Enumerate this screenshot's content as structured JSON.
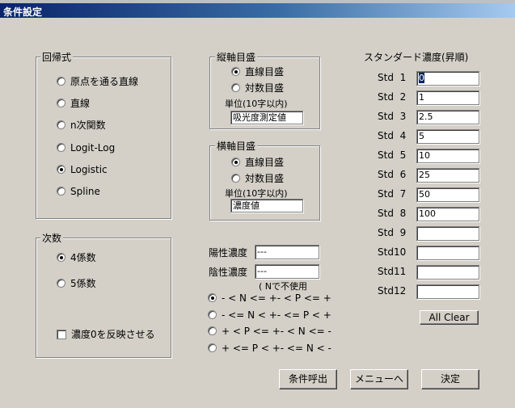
{
  "window": {
    "title": "条件設定"
  },
  "regression": {
    "label": "回帰式",
    "options": [
      "原点を通る直線",
      "直線",
      "n次関数",
      "Logit-Log",
      "Logistic",
      "Spline"
    ],
    "selected": 4
  },
  "vertical_axis": {
    "label": "縦軸目盛",
    "options": [
      "直線目盛",
      "対数目盛"
    ],
    "selected": 0,
    "unit_label": "単位(10字以内)",
    "unit_value": "吸光度測定値"
  },
  "horizontal_axis": {
    "label": "横軸目盛",
    "options": [
      "直線目盛",
      "対数目盛"
    ],
    "selected": 0,
    "unit_label": "単位(10字以内)",
    "unit_value": "濃度値"
  },
  "degree": {
    "label": "次数",
    "options": [
      "4係数",
      "5係数"
    ],
    "selected": 0,
    "reflect_zero_label": "濃度0を反映させる",
    "reflect_zero_checked": false
  },
  "judgement": {
    "positive_label": "陽性濃度",
    "positive_value": "---",
    "negative_label": "陰性濃度",
    "negative_value": "---",
    "note": "( Nで不使用",
    "options": [
      "- < N <= +- < P <= +",
      "- <= N < +- <= P < +",
      "+ < P <= +- < N <= -",
      "+ <= P < +- <= N < -"
    ],
    "selected": 0
  },
  "standards": {
    "title": "スタンダード濃度(昇順)",
    "items": [
      {
        "label": "Std  1",
        "value": "0"
      },
      {
        "label": "Std  2",
        "value": "1"
      },
      {
        "label": "Std  3",
        "value": "2.5"
      },
      {
        "label": "Std  4",
        "value": "5"
      },
      {
        "label": "Std  5",
        "value": "10"
      },
      {
        "label": "Std  6",
        "value": "25"
      },
      {
        "label": "Std  7",
        "value": "50"
      },
      {
        "label": "Std  8",
        "value": "100"
      },
      {
        "label": "Std  9",
        "value": ""
      },
      {
        "label": "Std10",
        "value": ""
      },
      {
        "label": "Std11",
        "value": ""
      },
      {
        "label": "Std12",
        "value": ""
      }
    ],
    "clear_label": "All Clear"
  },
  "footer": {
    "load_label": "条件呼出",
    "menu_label": "メニューへ",
    "ok_label": "決定"
  }
}
